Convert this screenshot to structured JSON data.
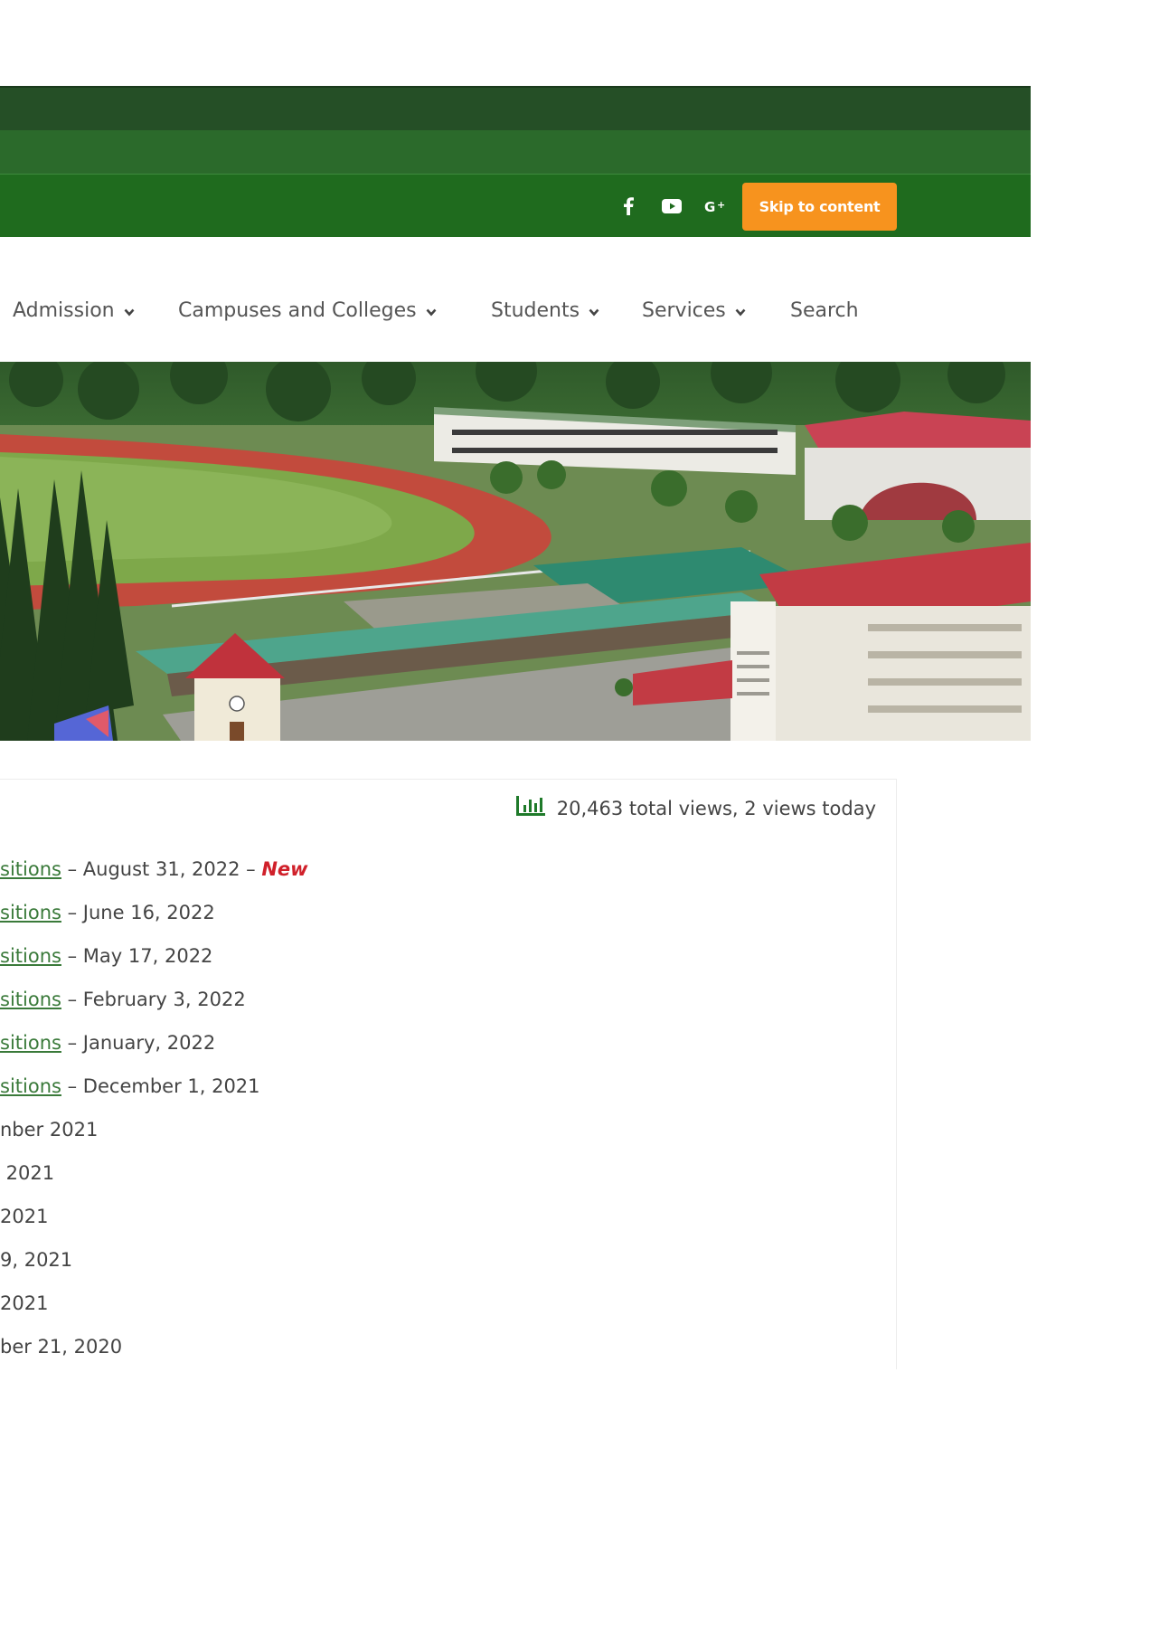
{
  "social": {
    "facebook_icon": "facebook-icon",
    "youtube_icon": "youtube-icon",
    "googleplus_icon": "google-plus-icon",
    "skip_label": "Skip to content"
  },
  "nav": {
    "items": [
      {
        "label": "Admission",
        "has_dropdown": true
      },
      {
        "label": "Campuses and Colleges",
        "has_dropdown": true
      },
      {
        "label": "Students",
        "has_dropdown": true
      },
      {
        "label": "Services",
        "has_dropdown": true
      },
      {
        "label": "Search",
        "has_dropdown": false
      }
    ]
  },
  "stats": {
    "icon": "bar-chart-icon",
    "text": "20,463 total views,  2 views today"
  },
  "list": [
    {
      "link": "sitions",
      "rest": " – August 31, 2022 – ",
      "badge": "New"
    },
    {
      "link": "sitions",
      "rest": " – June 16, 2022"
    },
    {
      "link": "sitions",
      "rest": " – May 17, 2022"
    },
    {
      "link": "sitions",
      "rest": " – February 3, 2022"
    },
    {
      "link": "sitions",
      "rest": " – January, 2022"
    },
    {
      "link": "sitions",
      "rest": " – December 1, 2021"
    },
    {
      "text": "nber 2021"
    },
    {
      "text": " 2021"
    },
    {
      "text": "2021"
    },
    {
      "text": "9, 2021"
    },
    {
      "text": "2021"
    },
    {
      "text": "ber 21, 2020"
    }
  ],
  "colors": {
    "topbar": "#1f6b1e",
    "accent": "#f7931e",
    "link": "#3a7a3a",
    "new_badge": "#d0202a"
  }
}
